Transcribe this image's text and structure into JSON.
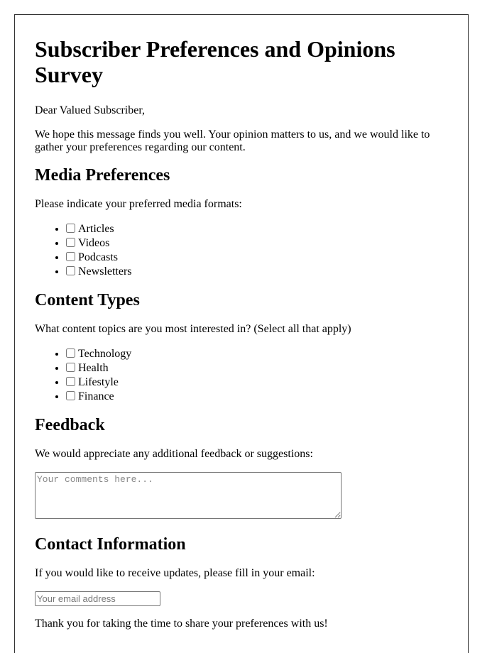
{
  "title": "Subscriber Preferences and Opinions Survey",
  "greeting": "Dear Valued Subscriber,",
  "intro": "We hope this message finds you well. Your opinion matters to us, and we would like to gather your preferences regarding our content.",
  "media": {
    "heading": "Media Preferences",
    "prompt": "Please indicate your preferred media formats:",
    "options": [
      {
        "label": "Articles",
        "checked": false
      },
      {
        "label": "Videos",
        "checked": false
      },
      {
        "label": "Podcasts",
        "checked": false
      },
      {
        "label": "Newsletters",
        "checked": false
      }
    ]
  },
  "content": {
    "heading": "Content Types",
    "prompt": "What content topics are you most interested in? (Select all that apply)",
    "options": [
      {
        "label": "Technology",
        "checked": false
      },
      {
        "label": "Health",
        "checked": false
      },
      {
        "label": "Lifestyle",
        "checked": false
      },
      {
        "label": "Finance",
        "checked": false
      }
    ]
  },
  "feedback": {
    "heading": "Feedback",
    "prompt": "We would appreciate any additional feedback or suggestions:",
    "placeholder": "Your comments here...",
    "value": ""
  },
  "contact": {
    "heading": "Contact Information",
    "prompt": "If you would like to receive updates, please fill in your email:",
    "placeholder": "Your email address",
    "value": ""
  },
  "closing": "Thank you for taking the time to share your preferences with us!"
}
